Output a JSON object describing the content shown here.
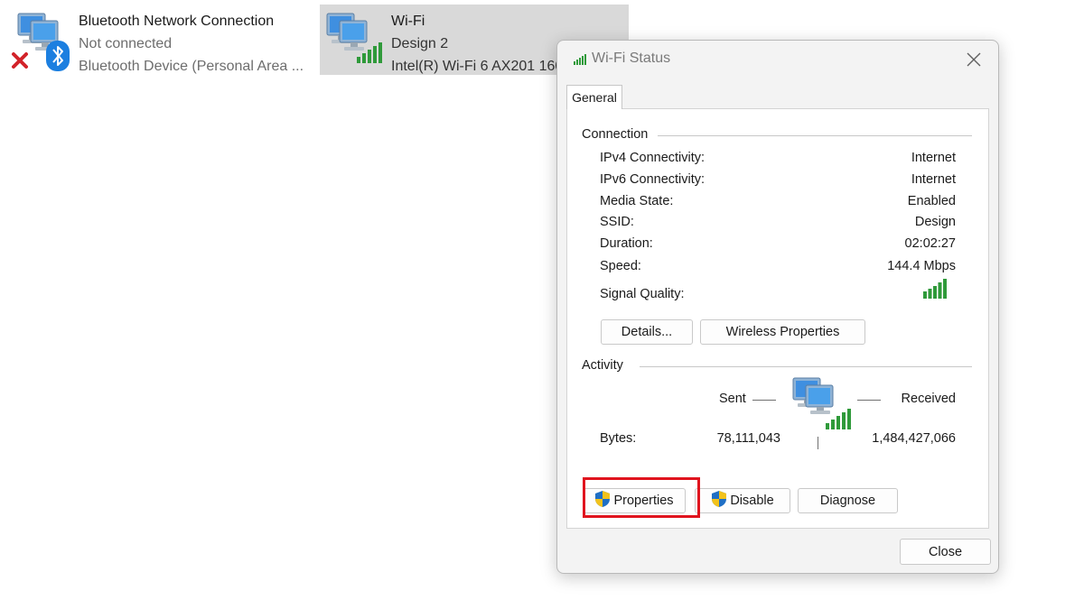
{
  "adapters": [
    {
      "name": "Bluetooth Network Connection",
      "status": "Not connected",
      "device": "Bluetooth Device (Personal Area ...",
      "icon": "network-computer-icon",
      "badges": [
        "red-x-icon",
        "bluetooth-icon"
      ]
    },
    {
      "name": "Wi-Fi",
      "status": "Design 2",
      "device": "Intel(R) Wi-Fi 6 AX201 160",
      "icon": "network-computer-icon",
      "badges": [
        "signal-bars-icon"
      ]
    }
  ],
  "dialog": {
    "title": "Wi-Fi Status",
    "tab": "General",
    "connection": {
      "label": "Connection",
      "rows": [
        {
          "label": "IPv4 Connectivity:",
          "value": "Internet"
        },
        {
          "label": "IPv6 Connectivity:",
          "value": "Internet"
        },
        {
          "label": "Media State:",
          "value": "Enabled"
        },
        {
          "label": "SSID:",
          "value": "Design"
        },
        {
          "label": "Duration:",
          "value": "02:02:27"
        },
        {
          "label": "Speed:",
          "value": "144.4 Mbps"
        }
      ],
      "signal_label": "Signal Quality:",
      "signal_bars": 5
    },
    "buttons": {
      "details": "Details...",
      "wireless_properties": "Wireless Properties",
      "properties": "Properties",
      "disable": "Disable",
      "diagnose": "Diagnose",
      "close": "Close"
    },
    "activity": {
      "label": "Activity",
      "sent_label": "Sent",
      "received_label": "Received",
      "bytes_label": "Bytes:",
      "bytes_sent": "78,111,043",
      "bytes_received": "1,484,427,066"
    }
  },
  "colors": {
    "highlight": "#e0141e",
    "signal_green": "#2f9a3a",
    "selected_tile": "#d9d9d9"
  }
}
